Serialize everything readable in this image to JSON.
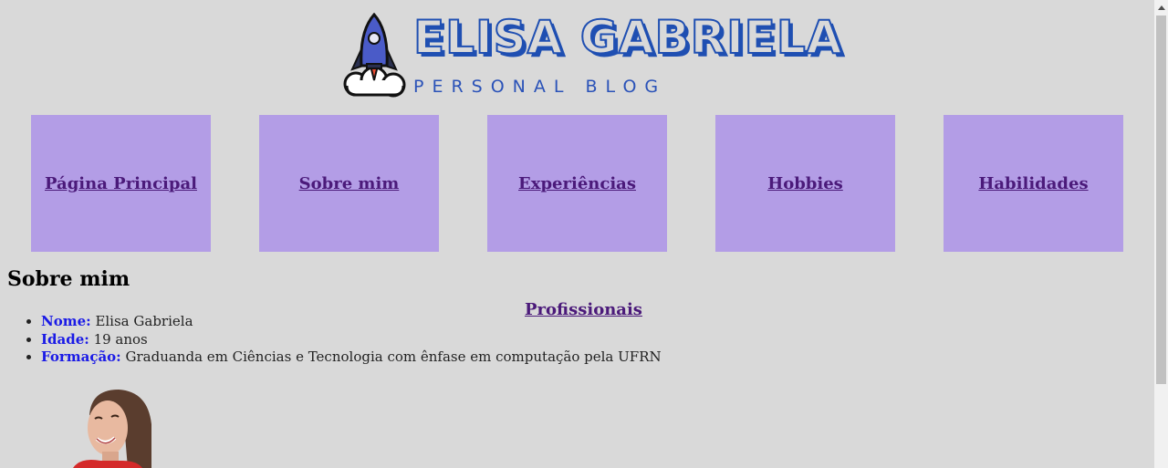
{
  "header": {
    "title": "ELISA GABRIELA",
    "subtitle": "PERSONAL BLOG",
    "logo_icon": "rocket-icon"
  },
  "nav": {
    "items": [
      {
        "label": "Página Principal"
      },
      {
        "label": "Sobre mim"
      },
      {
        "label": "Experiências"
      },
      {
        "label": "Hobbies"
      },
      {
        "label": "Habilidades"
      }
    ]
  },
  "about": {
    "title": "Sobre mim",
    "subnav_link": "Profissionais",
    "fields": [
      {
        "key": "Nome:",
        "value": " Elisa Gabriela"
      },
      {
        "key": "Idade:",
        "value": " 19 anos"
      },
      {
        "key": "Formação:",
        "value": " Graduanda em Ciências e Tecnologia com ênfase em computação pela UFRN"
      }
    ]
  },
  "colors": {
    "background": "#d9d9d9",
    "nav_box": "#b39de6",
    "link": "#4b1a7a",
    "logo_blue": "#1f4fb2",
    "field_label": "#1a1ae6"
  }
}
